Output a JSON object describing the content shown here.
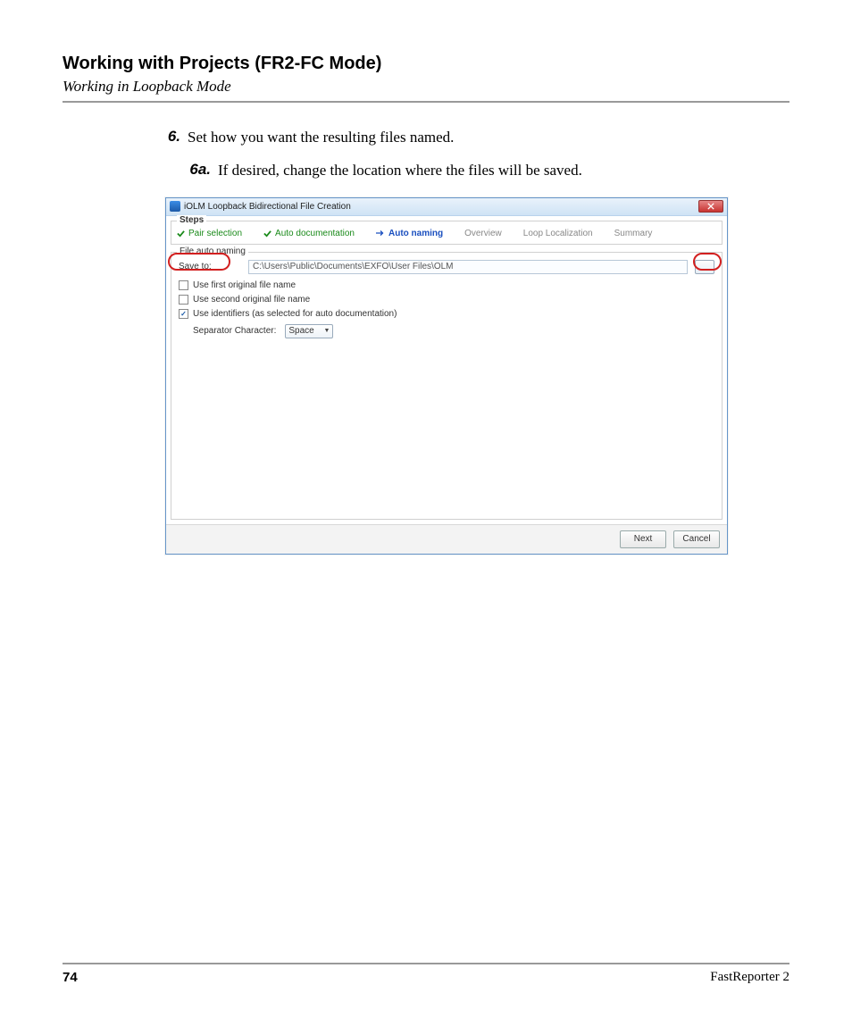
{
  "header": {
    "title": "Working with Projects (FR2-FC Mode)",
    "subtitle": "Working in Loopback Mode"
  },
  "steps": {
    "s6_num": "6.",
    "s6_text": "Set how you want the resulting files named.",
    "s6a_num": "6a.",
    "s6a_text": "If desired, change the location where the files will be saved."
  },
  "dialog": {
    "title": "iOLM Loopback Bidirectional File Creation",
    "steps_label": "Steps",
    "tabs": {
      "pair": "Pair selection",
      "auto_doc": "Auto documentation",
      "auto_naming": "Auto naming",
      "overview": "Overview",
      "loop_loc": "Loop Localization",
      "summary": "Summary"
    },
    "group_label": "File auto naming",
    "save_to_label": "Save to:",
    "save_to_value": "C:\\Users\\Public\\Documents\\EXFO\\User Files\\OLM",
    "browse_label": "...",
    "cb1": "Use first original file name",
    "cb2": "Use second original file name",
    "cb3": "Use identifiers (as selected for auto documentation)",
    "sep_label": "Separator Character:",
    "sep_value": "Space",
    "next": "Next",
    "cancel": "Cancel"
  },
  "footer": {
    "page": "74",
    "product": "FastReporter 2"
  }
}
